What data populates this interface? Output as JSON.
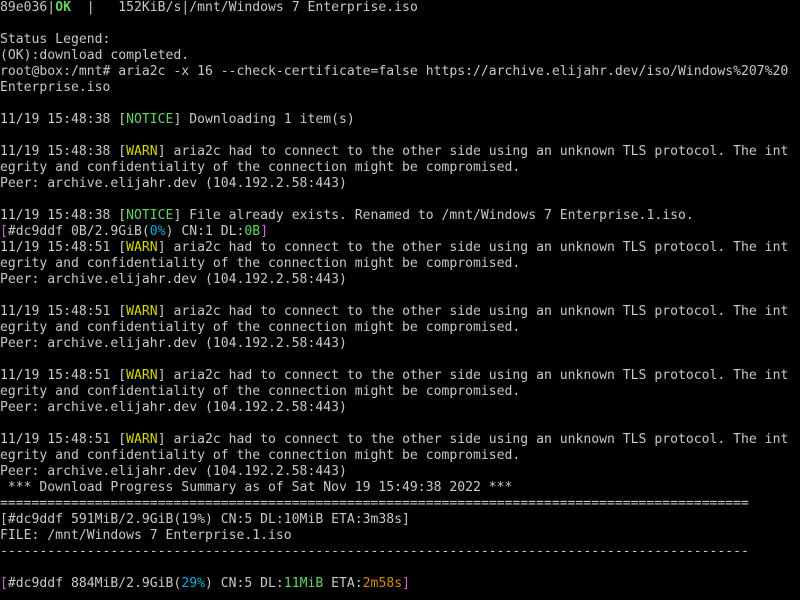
{
  "colors": {
    "background": "#000000",
    "text": "#c8c8c8",
    "ok_green": "#5fd75f",
    "notice_green": "#5fd75f",
    "warn_yellow": "#d7d700",
    "gid_magenta": "#d75fd7",
    "percent_cyan": "#00afd7",
    "eta_orange": "#d78700"
  },
  "terminal": {
    "lines": [
      [
        {
          "t": "89e036|",
          "c": "c-white"
        },
        {
          "t": "OK",
          "c": "c-green bold"
        },
        {
          "t": "  |   152KiB/s|/mnt/Windows 7 Enterprise.iso",
          "c": "c-white"
        }
      ],
      [],
      [
        {
          "t": "Status Legend:",
          "c": "c-white"
        }
      ],
      [
        {
          "t": "(OK):download completed.",
          "c": "c-white"
        }
      ],
      [
        {
          "t": "root@box:/mnt# aria2c -x 16 --check-certificate=false https://archive.elijahr.dev/iso/Windows%207%20",
          "c": "c-white"
        }
      ],
      [
        {
          "t": "Enterprise.iso",
          "c": "c-white"
        }
      ],
      [],
      [
        {
          "t": "11/19 15:48:38 [",
          "c": "c-white"
        },
        {
          "t": "NOTICE",
          "c": "c-green"
        },
        {
          "t": "] Downloading 1 item(s)",
          "c": "c-white"
        }
      ],
      [],
      [
        {
          "t": "11/19 15:48:38 [",
          "c": "c-white"
        },
        {
          "t": "WARN",
          "c": "c-yellow"
        },
        {
          "t": "] aria2c had to connect to the other side using an unknown TLS protocol. The int",
          "c": "c-white"
        }
      ],
      [
        {
          "t": "egrity and confidentiality of the connection might be compromised.",
          "c": "c-white"
        }
      ],
      [
        {
          "t": "Peer: archive.elijahr.dev (104.192.2.58:443)",
          "c": "c-white"
        }
      ],
      [],
      [
        {
          "t": "11/19 15:48:38 [",
          "c": "c-white"
        },
        {
          "t": "NOTICE",
          "c": "c-green"
        },
        {
          "t": "] File already exists. Renamed to /mnt/Windows 7 Enterprise.1.iso.",
          "c": "c-white"
        }
      ],
      [
        {
          "t": "[",
          "c": "c-magenta"
        },
        {
          "t": "#dc9ddf 0B/2.9GiB(",
          "c": "c-white"
        },
        {
          "t": "0%",
          "c": "c-cyan"
        },
        {
          "t": ") CN:1 DL:",
          "c": "c-white"
        },
        {
          "t": "0B",
          "c": "c-green"
        },
        {
          "t": "]",
          "c": "c-magenta"
        }
      ],
      [
        {
          "t": "11/19 15:48:51 [",
          "c": "c-white"
        },
        {
          "t": "WARN",
          "c": "c-yellow"
        },
        {
          "t": "] aria2c had to connect to the other side using an unknown TLS protocol. The int",
          "c": "c-white"
        }
      ],
      [
        {
          "t": "egrity and confidentiality of the connection might be compromised.",
          "c": "c-white"
        }
      ],
      [
        {
          "t": "Peer: archive.elijahr.dev (104.192.2.58:443)",
          "c": "c-white"
        }
      ],
      [],
      [
        {
          "t": "11/19 15:48:51 [",
          "c": "c-white"
        },
        {
          "t": "WARN",
          "c": "c-yellow"
        },
        {
          "t": "] aria2c had to connect to the other side using an unknown TLS protocol. The int",
          "c": "c-white"
        }
      ],
      [
        {
          "t": "egrity and confidentiality of the connection might be compromised.",
          "c": "c-white"
        }
      ],
      [
        {
          "t": "Peer: archive.elijahr.dev (104.192.2.58:443)",
          "c": "c-white"
        }
      ],
      [],
      [
        {
          "t": "11/19 15:48:51 [",
          "c": "c-white"
        },
        {
          "t": "WARN",
          "c": "c-yellow"
        },
        {
          "t": "] aria2c had to connect to the other side using an unknown TLS protocol. The int",
          "c": "c-white"
        }
      ],
      [
        {
          "t": "egrity and confidentiality of the connection might be compromised.",
          "c": "c-white"
        }
      ],
      [
        {
          "t": "Peer: archive.elijahr.dev (104.192.2.58:443)",
          "c": "c-white"
        }
      ],
      [],
      [
        {
          "t": "11/19 15:48:51 [",
          "c": "c-white"
        },
        {
          "t": "WARN",
          "c": "c-yellow"
        },
        {
          "t": "] aria2c had to connect to the other side using an unknown TLS protocol. The int",
          "c": "c-white"
        }
      ],
      [
        {
          "t": "egrity and confidentiality of the connection might be compromised.",
          "c": "c-white"
        }
      ],
      [
        {
          "t": "Peer: archive.elijahr.dev (104.192.2.58:443)",
          "c": "c-white"
        }
      ],
      [
        {
          "t": " *** Download Progress Summary as of Sat Nov 19 15:49:38 2022 ***",
          "c": "c-white"
        }
      ],
      [
        {
          "t": "===============================================================================================",
          "c": "c-white"
        }
      ],
      [
        {
          "t": "[#dc9ddf 591MiB/2.9GiB(19%) CN:5 DL:10MiB ETA:3m38s]",
          "c": "c-white"
        }
      ],
      [
        {
          "t": "FILE: /mnt/Windows 7 Enterprise.1.iso",
          "c": "c-white"
        }
      ],
      [
        {
          "t": "-----------------------------------------------------------------------------------------------",
          "c": "c-white"
        }
      ],
      [],
      [
        {
          "t": "[",
          "c": "c-magenta"
        },
        {
          "t": "#dc9ddf 884MiB/2.9GiB(",
          "c": "c-white"
        },
        {
          "t": "29%",
          "c": "c-cyan"
        },
        {
          "t": ") CN:5 DL:",
          "c": "c-white"
        },
        {
          "t": "11MiB",
          "c": "c-green"
        },
        {
          "t": " ETA:",
          "c": "c-white"
        },
        {
          "t": "2m58s",
          "c": "c-orange"
        },
        {
          "t": "]",
          "c": "c-magenta"
        }
      ]
    ]
  }
}
